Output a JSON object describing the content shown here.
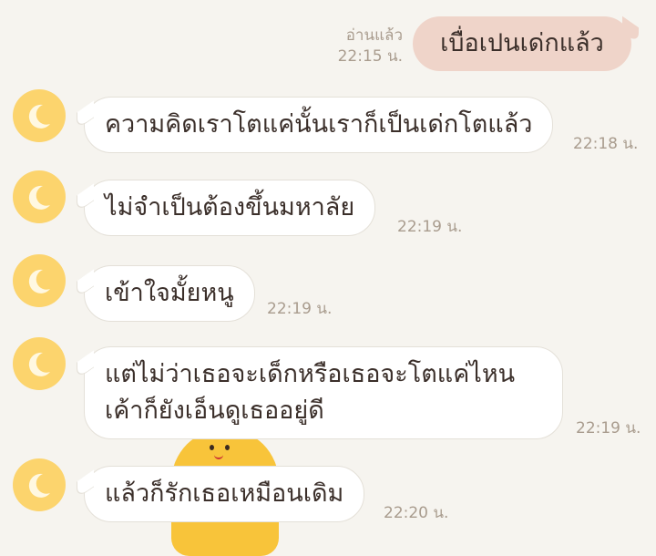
{
  "sent": {
    "read_status": "อ่านแล้ว",
    "time": "22:15 น.",
    "text": "เบื่อเปนเด่กแล้ว"
  },
  "messages": [
    {
      "text": "ความคิดเราโตแค่นั้นเราก็เป็นเด่กโตแล้ว",
      "time": "22:18 น."
    },
    {
      "text": "ไม่จำเป็นต้องขึ้นมหาลัย",
      "time": "22:19 น."
    },
    {
      "text": "เข้าใจมั้ยหนู",
      "time": "22:19 น."
    },
    {
      "text_line1": "แต่ไม่ว่าเธอจะเด็กหรือเธอจะโตแค่ไหน",
      "text_line2": "เค้าก็ยังเอ็นดูเธออยู่ดี",
      "time": "22:19 น."
    },
    {
      "text": "แล้วก็รักเธอเหมือนเดิม",
      "time": "22:20 น."
    }
  ],
  "avatar_icon": "crescent-moon-icon",
  "colors": {
    "background": "#f6f4ef",
    "sent_bubble": "#efd4c9",
    "received_bubble": "#ffffff",
    "avatar": "#fcd46d",
    "timestamp": "#a99c8e"
  }
}
